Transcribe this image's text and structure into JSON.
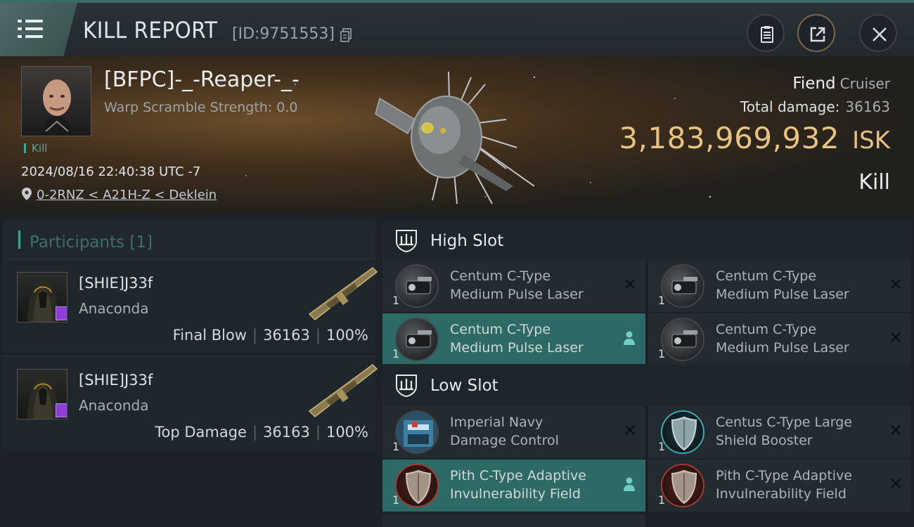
{
  "header": {
    "title": "KILL REPORT",
    "report_id": "[ID:9751553]"
  },
  "victim": {
    "name": "[BFPC]-_-Reaper-_-",
    "warp_scramble": "Warp Scramble Strength: 0.0",
    "kill_tag": "Kill",
    "datetime": "2024/08/16 22:40:38 UTC -7",
    "location": "0-2RNZ < A21H-Z < Deklein",
    "ship_name": "Fiend",
    "ship_class": "Cruiser",
    "total_damage_label": "Total damage:",
    "total_damage": "36163",
    "isk_value": "3,183,969,932",
    "isk_unit": "ISK",
    "result": "Kill"
  },
  "participants": {
    "header": "Participants [1]",
    "rows": [
      {
        "name": "[SHIE]J33f",
        "ship": "Anaconda",
        "role": "Final Blow",
        "damage": "36163",
        "percent": "100%"
      },
      {
        "name": "[SHIE]J33f",
        "ship": "Anaconda",
        "role": "Top Damage",
        "damage": "36163",
        "percent": "100%"
      }
    ]
  },
  "fitting": {
    "high_slot_label": "High Slot",
    "low_slot_label": "Low Slot",
    "high": [
      {
        "name_line1": "Centum C-Type",
        "name_line2": "Medium Pulse Laser",
        "qty": "1",
        "state": "destroyed"
      },
      {
        "name_line1": "Centum C-Type",
        "name_line2": "Medium Pulse Laser",
        "qty": "1",
        "state": "destroyed"
      },
      {
        "name_line1": "Centum C-Type",
        "name_line2": "Medium Pulse Laser",
        "qty": "1",
        "state": "dropped"
      },
      {
        "name_line1": "Centum C-Type",
        "name_line2": "Medium Pulse Laser",
        "qty": "1",
        "state": "destroyed"
      }
    ],
    "low": [
      {
        "name_line1": "Imperial Navy",
        "name_line2": "Damage Control",
        "qty": "1",
        "state": "destroyed"
      },
      {
        "name_line1": "Centus C-Type Large",
        "name_line2": "Shield Booster",
        "qty": "1",
        "state": "destroyed"
      },
      {
        "name_line1": "Pith C-Type Adaptive",
        "name_line2": "Invulnerability Field",
        "qty": "1",
        "state": "dropped"
      },
      {
        "name_line1": "Pith C-Type Adaptive",
        "name_line2": "Invulnerability Field",
        "qty": "1",
        "state": "destroyed"
      }
    ]
  },
  "colors": {
    "accent_teal": "#3ea79a",
    "isk_gold": "#e8c280",
    "dropped_row": "#2e6a65"
  },
  "icons": [
    "menu-icon",
    "copy-icon",
    "clipboard-icon",
    "share-icon",
    "close-icon",
    "location-pin-icon",
    "shield-slot-icon",
    "destroyed-x-icon",
    "dropped-person-icon"
  ]
}
